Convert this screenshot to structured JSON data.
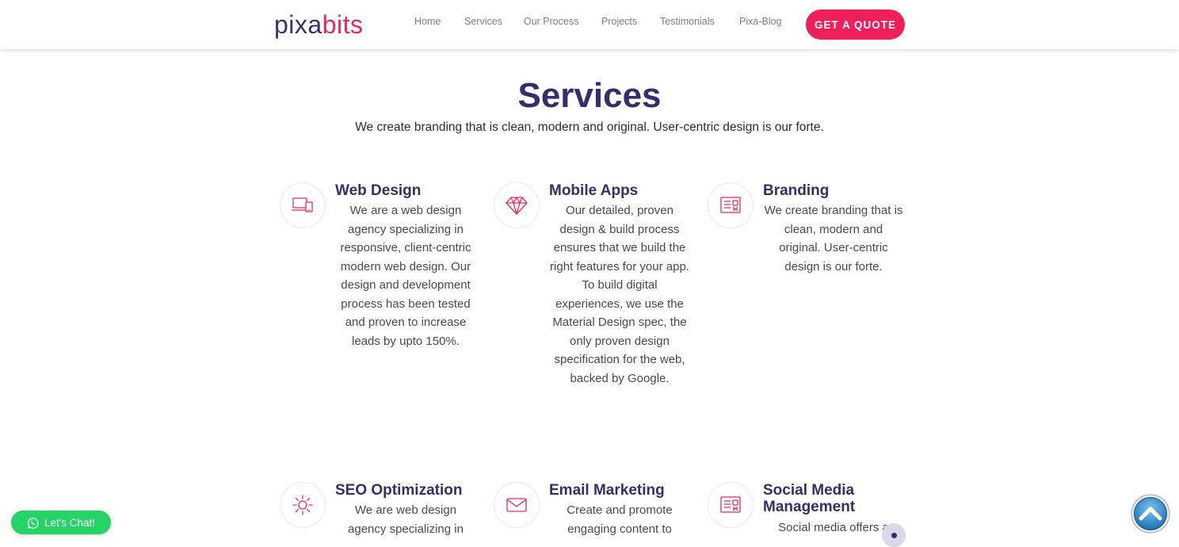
{
  "brand": {
    "logo_part1": "pixa",
    "logo_part2": "bits",
    "primary_color": "#36326d",
    "accent_color": "#e8285c"
  },
  "nav": {
    "items": [
      {
        "label": "Home"
      },
      {
        "label": "Services"
      },
      {
        "label": "Our Process"
      },
      {
        "label": "Projects"
      },
      {
        "label": "Testimonials"
      },
      {
        "label": "Pixa-Blog"
      }
    ],
    "cta_label": "GET A QUOTE"
  },
  "services": {
    "title": "Services",
    "subtitle": "We create branding that is clean, modern and original. User-centric design is our forte.",
    "cards": [
      {
        "icon": "laptop-mobile-icon",
        "title": "Web Design",
        "description": "We are a web design agency specializing in responsive, client-centric modern web design. Our design and development process has been tested and proven to increase leads by upto 150%."
      },
      {
        "icon": "diamond-icon",
        "title": "Mobile Apps",
        "description": "Our detailed, proven design & build process ensures that we build the right features for your app. To build digital experiences, we use the Material Design spec, the only proven design specification for the web, backed by Google."
      },
      {
        "icon": "news-card-icon",
        "title": "Branding",
        "description": "We create branding that is clean, modern and original. User-centric design is our forte."
      },
      {
        "icon": "sun-icon",
        "title": "SEO Optimization",
        "description": "We are web design agency specializing in"
      },
      {
        "icon": "envelope-icon",
        "title": "Email Marketing",
        "description": "Create and promote engaging content to"
      },
      {
        "icon": "news-card-icon",
        "title": "Social Media Management",
        "description": "Social media offers a"
      }
    ]
  },
  "widgets": {
    "chat_label": "Let's Chat!",
    "chat_color": "#25d366"
  }
}
